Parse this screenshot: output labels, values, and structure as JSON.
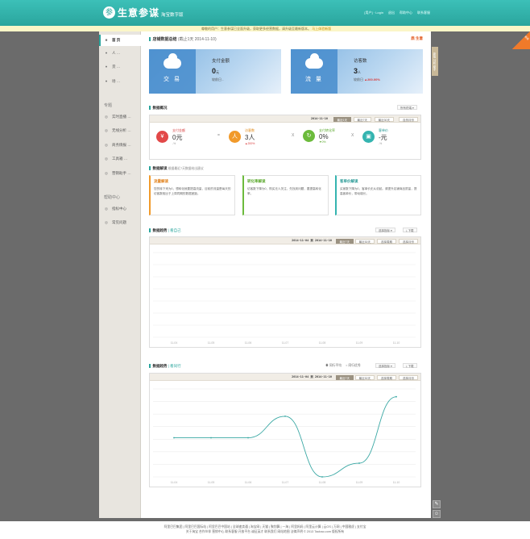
{
  "header": {
    "logo_mark": "参",
    "title": "生意参谋",
    "subtitle": "淘宝数字版",
    "links": [
      "[用户] · Login",
      "退出",
      "帮助中心",
      "联系客服"
    ]
  },
  "notice": {
    "text": "尊敬的用户：生意参谋已全面升级，获取更多经营数据，请升级至最新版本。",
    "link": "马上体验新版"
  },
  "sidebar": {
    "items": [
      {
        "icon": "■",
        "label": "首 页",
        "active": true
      },
      {
        "icon": "●",
        "label": "人 …"
      },
      {
        "icon": "●",
        "label": "货 …"
      },
      {
        "icon": "●",
        "label": "场 …"
      }
    ],
    "section1": "专题",
    "topics": [
      {
        "icon": "◎",
        "label": "实时直播 …"
      },
      {
        "icon": "◎",
        "label": "无线分析 …"
      },
      {
        "icon": "◎",
        "label": "商务情报 …"
      },
      {
        "icon": "◎",
        "label": "工具箱 …"
      },
      {
        "icon": "◎",
        "label": "营销助手 …"
      }
    ],
    "section2": "帮助中心",
    "help": [
      {
        "icon": "◎",
        "label": "指标中心"
      },
      {
        "icon": "◎",
        "label": "常见问题"
      }
    ]
  },
  "main": {
    "title": "店铺数据总结",
    "date_range": "(截止1天 2014-11-10)",
    "brand_badge": "鼎 生意",
    "cards": [
      {
        "tile": "交 易",
        "metric": "支付金额",
        "value": "0",
        "unit": "元",
        "cmp_label": "较前日",
        "cmp_value": "-"
      },
      {
        "tile": "流 量",
        "metric": "访客数",
        "value": "3",
        "unit": "人",
        "cmp_label": "较前日",
        "cmp_value": "▲200.00%"
      }
    ],
    "overview": {
      "title": "数据概况",
      "dropdown": "所有终端",
      "date": "2014-11-10",
      "periods": [
        "最近1天",
        "最近7天",
        "最近30天",
        "自然月份"
      ],
      "kpis": [
        {
          "icon": "¥",
          "label": "支付金额",
          "value": "0元",
          "cmp": "-%",
          "color": "#e24848"
        },
        {
          "icon": "人",
          "label": "访客数",
          "value": "3人",
          "cmp": "▲200%",
          "color": "#f19a2a"
        },
        {
          "icon": "↻",
          "label": "支付转化率",
          "value": "0%",
          "cmp": "▼0%",
          "color": "#6cbb3c"
        },
        {
          "icon": "▣",
          "label": "客单价",
          "value": "-元",
          "cmp": "-%",
          "color": "#34b4b0"
        }
      ],
      "ops": [
        "=",
        "X",
        "X"
      ]
    },
    "interpretation": {
      "title": "数据解读",
      "subtitle": "根据最近7天数据给出建议",
      "tips": [
        {
          "title": "流量解读",
          "body": "您的转下来为0，想转化就要提高流量，目前的流量是每天的访客数相比于上周同期的数据差距。",
          "color": "#f19a2a"
        },
        {
          "title": "转化率解读",
          "body": "访客数下降为0，购买无人关注，先找到问题，要提高转化率。",
          "color": "#6cbb3c"
        },
        {
          "title": "客单价解读",
          "body": "买家数下降为0，客单价无从说起。请提升店铺商品质量，提高客单价，带动增长。",
          "color": "#34b4b0"
        }
      ]
    },
    "trend1": {
      "title": "数据趋势",
      "sub": "| 看自己",
      "select": "选择指标",
      "download": "下载",
      "date_range": "2014-11-04 到 2014-11-10",
      "periods": [
        "最近7天",
        "最近30天",
        "选择周期",
        "选择月份"
      ],
      "x_labels": [
        "11-04",
        "11-05",
        "11-06",
        "11-07",
        "11-08",
        "11-09",
        "11-10"
      ]
    },
    "trend2": {
      "title": "数据趋势",
      "sub": "| 看同行",
      "radio1": "同行平均",
      "radio2": "同行优秀",
      "select": "选择指标",
      "download": "下载",
      "date_range": "2014-11-04 到 2014-11-10",
      "periods": [
        "最近7天",
        "最近30天",
        "选择周期",
        "选择月份"
      ],
      "x_labels": [
        "11-04",
        "11-05",
        "11-06",
        "11-07",
        "11-08",
        "11-09",
        "11-10"
      ]
    }
  },
  "chart_data": {
    "type": "line",
    "x": [
      "11-04",
      "11-05",
      "11-06",
      "11-07",
      "11-08",
      "11-09",
      "11-10"
    ],
    "series": [
      {
        "values": [
          2,
          2,
          2,
          3.1,
          0,
          0.7,
          4.1
        ]
      }
    ],
    "line_color": "#3aa8a4"
  },
  "right_tab": "新版 分析 助手",
  "ribbon": "新版",
  "footer": {
    "line1": "阿里巴巴集团 | 阿里巴巴国际站 | 阿里巴巴中国站 | 全球速卖通 | 淘宝网 | 天猫 | 聚划算 | 一淘 | 阿里妈妈 | 阿里云计算 | 云OS | 万网 | 中国雅虎 | 支付宝",
    "line2": "关于淘宝  合作伙伴  营销中心  联系客服  开放平台  诚征英才  联系我们  网站地图  法律声明  © 2013 Taobao.com 版权所有"
  }
}
